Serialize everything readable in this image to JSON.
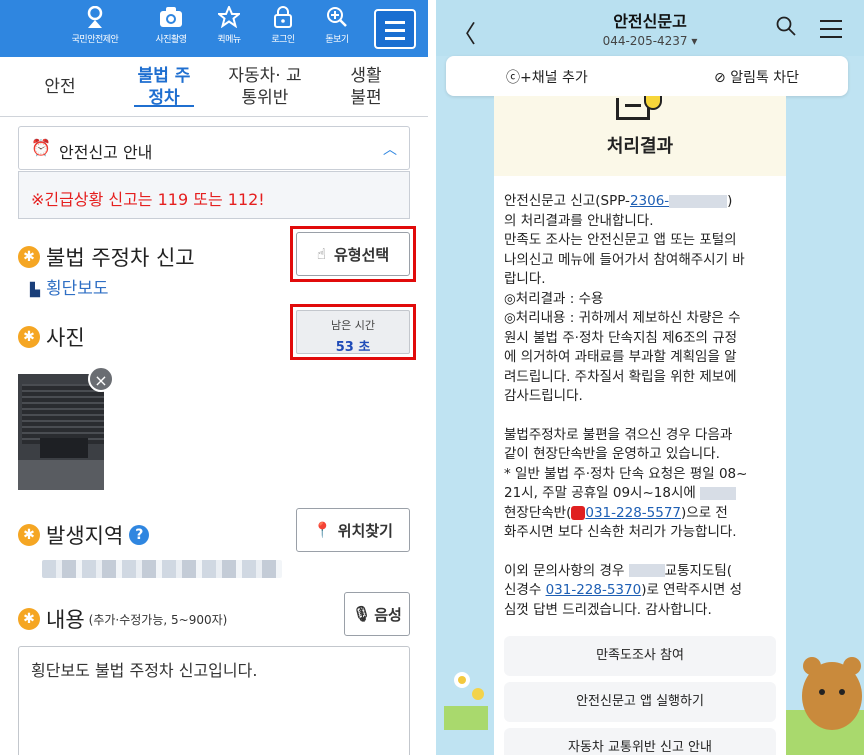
{
  "left": {
    "topbar": {
      "items": [
        {
          "icon": "badge-icon",
          "label": "국민안전제안"
        },
        {
          "icon": "camera-icon",
          "label": "사진촬영"
        },
        {
          "icon": "star-icon",
          "label": "퀵메뉴"
        },
        {
          "icon": "lock-icon",
          "label": "로그인"
        },
        {
          "icon": "zoom-in-icon",
          "label": "돋보기"
        }
      ],
      "menu_icon": "hamburger-icon",
      "color": "#2f86e0"
    },
    "tabs": [
      {
        "label": "안전",
        "active": false
      },
      {
        "label": "불법 주정차",
        "active": true
      },
      {
        "label": "자동차· 교통위반",
        "active": false
      },
      {
        "label": "생활 불편",
        "active": false
      }
    ],
    "notice": {
      "label": "안전신고 안내",
      "icon": "alarm-bell-icon",
      "expanded": true
    },
    "emergency": "※긴급상황 신고는 119 또는 112!",
    "report_type": {
      "title": "불법 주정차 신고",
      "selected": "횡단보도",
      "button": "유형선택"
    },
    "photo": {
      "title": "사진",
      "timer_label": "남은 시간",
      "timer_value": "53 초"
    },
    "location": {
      "title": "발생지역",
      "button": "위치찾기"
    },
    "content": {
      "title": "내용",
      "hint": "(추가·수정가능, 5~900자)",
      "voice_button": "음성",
      "value": "횡단보도 불법 주정차 신고입니다."
    }
  },
  "right": {
    "header": {
      "title": "안전신문고",
      "phone": "044-205-4237 ▾"
    },
    "channel": {
      "add": "+채널 추가",
      "block": "알림톡 차단"
    },
    "card": {
      "title": "처리결과",
      "p1": {
        "line1_pre": "안전신문고 신고(SPP-",
        "line1_link": "2306-",
        "line1_post": ")",
        "line2": "의 처리결과를 안내합니다.",
        "line3": "만족도 조사는 안전신문고 앱 또는 포털의",
        "line4": "나의신고 메뉴에 들어가서 참여해주시기 바",
        "line5": "랍니다.",
        "line6": "◎처리결과 : 수용",
        "line7": "◎처리내용 : 귀하께서 제보하신 차량은 수",
        "line8": "원시 불법 주·정차 단속지침 제6조의 규정",
        "line9": "에 의거하여 과태료를 부과할 계획임을 알",
        "line10": "려드립니다. 주차질서 확립을 위한 제보에",
        "line11": "감사드립니다."
      },
      "p2": {
        "line1": "불법주정차로 불편을 겪으신 경우 다음과",
        "line2": "같이 현장단속반을 운영하고 있습니다.",
        "line3": "* 일반 불법 주·정차 단속 요청은 평일 08~",
        "line4": "21시, 주말 공휴일 09시~18시에",
        "line5_pre": "현장단속반(",
        "line5_link": "031-228-5577",
        "line5_post": ")으로 전",
        "line6": "화주시면 보다 신속한 처리가 가능합니다."
      },
      "p3": {
        "line1_pre": "이외 문의사항의 경우",
        "line1_post": "교통지도팀(",
        "line2_pre": "신경수 ",
        "line2_link": "031-228-5370",
        "line2_post": ")로 연락주시면 성",
        "line3": "심껏 답변 드리겠습니다. 감사합니다."
      },
      "buttons": [
        "만족도조사 참여",
        "안전신문고 앱 실행하기",
        "자동차 교통위반 신고 안내"
      ]
    }
  }
}
